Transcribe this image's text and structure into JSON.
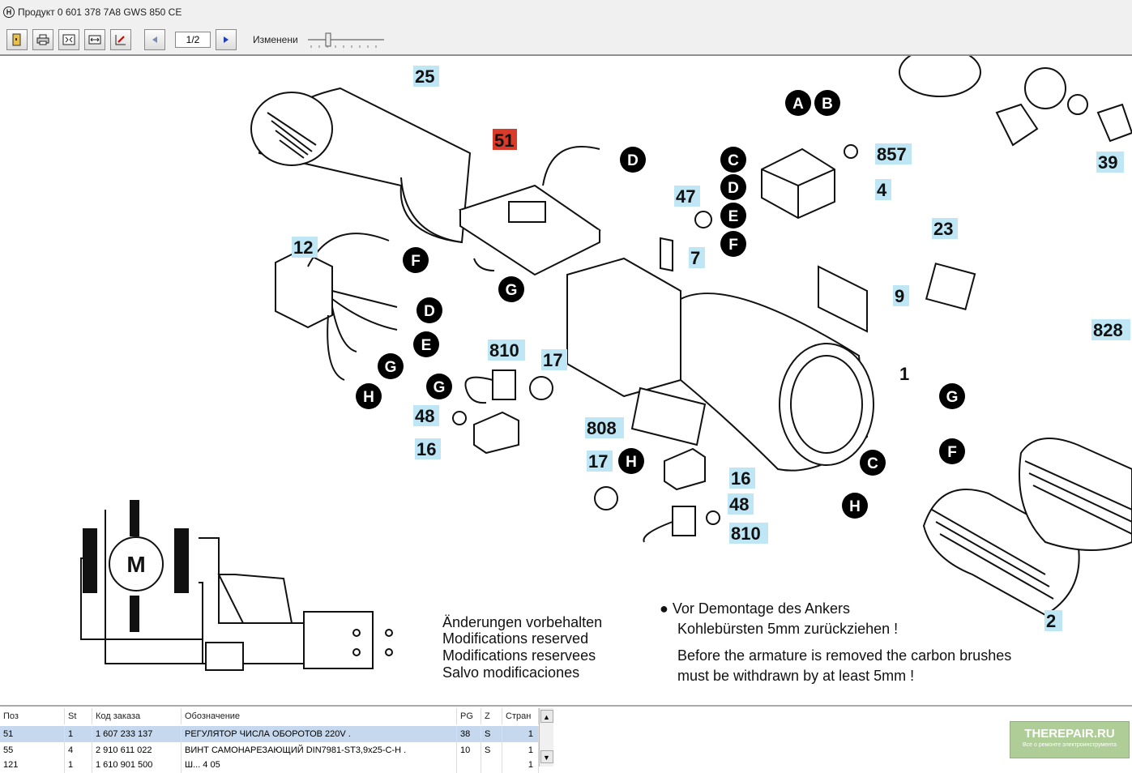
{
  "window": {
    "title": "Продукт 0 601 378 7A8    GWS 850 CE",
    "icon_letter": "H"
  },
  "toolbar": {
    "page_indicator": "1/2",
    "zoom_label": "Изменени"
  },
  "diagram": {
    "labels": [
      "25",
      "51",
      "857",
      "4",
      "47",
      "7",
      "23",
      "9",
      "12",
      "828",
      "1",
      "39",
      "810",
      "17",
      "48",
      "16",
      "808",
      "17",
      "16",
      "48",
      "810",
      "2"
    ],
    "callouts": [
      "A",
      "B",
      "C",
      "D",
      "E",
      "F",
      "D",
      "F",
      "D",
      "E",
      "G",
      "H",
      "G",
      "G",
      "F",
      "C",
      "H",
      "H"
    ],
    "motor_symbol": "M",
    "notes_left": [
      "Änderungen vorbehalten",
      "Modifications reserved",
      "Modifications reservees",
      "Salvo modificaciones"
    ],
    "notes_right": [
      "● Vor Demontage des Ankers",
      "Kohlebürsten 5mm zurückziehen !",
      "Before the armature is removed the carbon brushes",
      "must be withdrawn by at least 5mm !"
    ]
  },
  "table": {
    "headers": [
      "Поз",
      "St",
      "Код заказа",
      "Обозначение",
      "PG",
      "Z",
      "Стран"
    ],
    "rows": [
      [
        "51",
        "1",
        "1 607 233 137",
        "РЕГУЛЯТОР ЧИСЛА ОБОРОТОВ  220V .",
        "38",
        "S",
        "1"
      ],
      [
        "55",
        "4",
        "2 910 611 022",
        "ВИНТ САМОНАРЕЗАЮЩИЙ  DIN7981-ST3,9x25-C-H .",
        "10",
        "S",
        "1"
      ],
      [
        "121",
        "1",
        "1 610 901 500",
        "Ш...  4  05",
        "",
        "",
        "1"
      ]
    ]
  },
  "watermark": {
    "text": "THEREPAIR.RU",
    "sub": "Все о ремонте электроинструмента"
  }
}
